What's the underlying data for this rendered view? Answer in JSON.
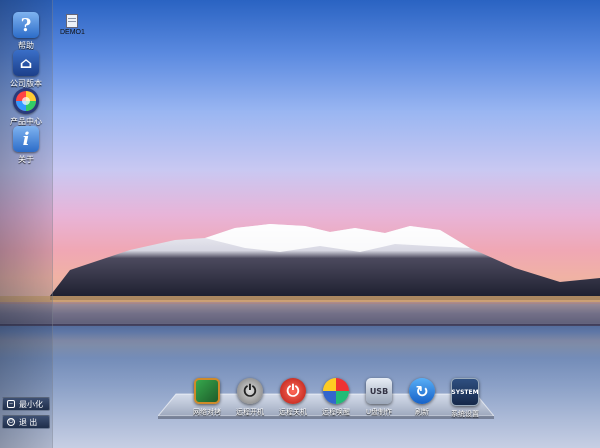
{
  "sidebar": {
    "items": [
      {
        "label": "帮助",
        "icon": "help-icon",
        "glyph": "?"
      },
      {
        "label": "公司版本",
        "icon": "home-icon",
        "glyph": "⌂"
      },
      {
        "label": "产品中心",
        "icon": "color-wheel-icon",
        "glyph": ""
      },
      {
        "label": "关于",
        "icon": "info-icon",
        "glyph": "i"
      }
    ],
    "minimize_label": "最小化",
    "exit_label": "退 出"
  },
  "desktop_file": {
    "label": "DEMO1",
    "icon": "file-icon"
  },
  "dock": {
    "items": [
      {
        "label": "网络对拷",
        "icon": "network-copy-icon",
        "glyph": ""
      },
      {
        "label": "远程开机",
        "icon": "power-on-icon",
        "glyph": "⏻"
      },
      {
        "label": "远程关机",
        "icon": "power-off-icon",
        "glyph": "⏻"
      },
      {
        "label": "远程唤醒",
        "icon": "wake-icon",
        "glyph": ""
      },
      {
        "label": "U盘制作",
        "icon": "disk-icon",
        "glyph": "USB"
      },
      {
        "label": "刷新",
        "icon": "refresh-icon",
        "glyph": "↻"
      },
      {
        "label": "系统设置",
        "icon": "system-icon",
        "glyph": "SYSTEM"
      }
    ]
  },
  "colors": {
    "sidebar_tint": "#1e283c",
    "button_bg": "#2a3b5c",
    "accent_blue": "#2c6cc8"
  }
}
